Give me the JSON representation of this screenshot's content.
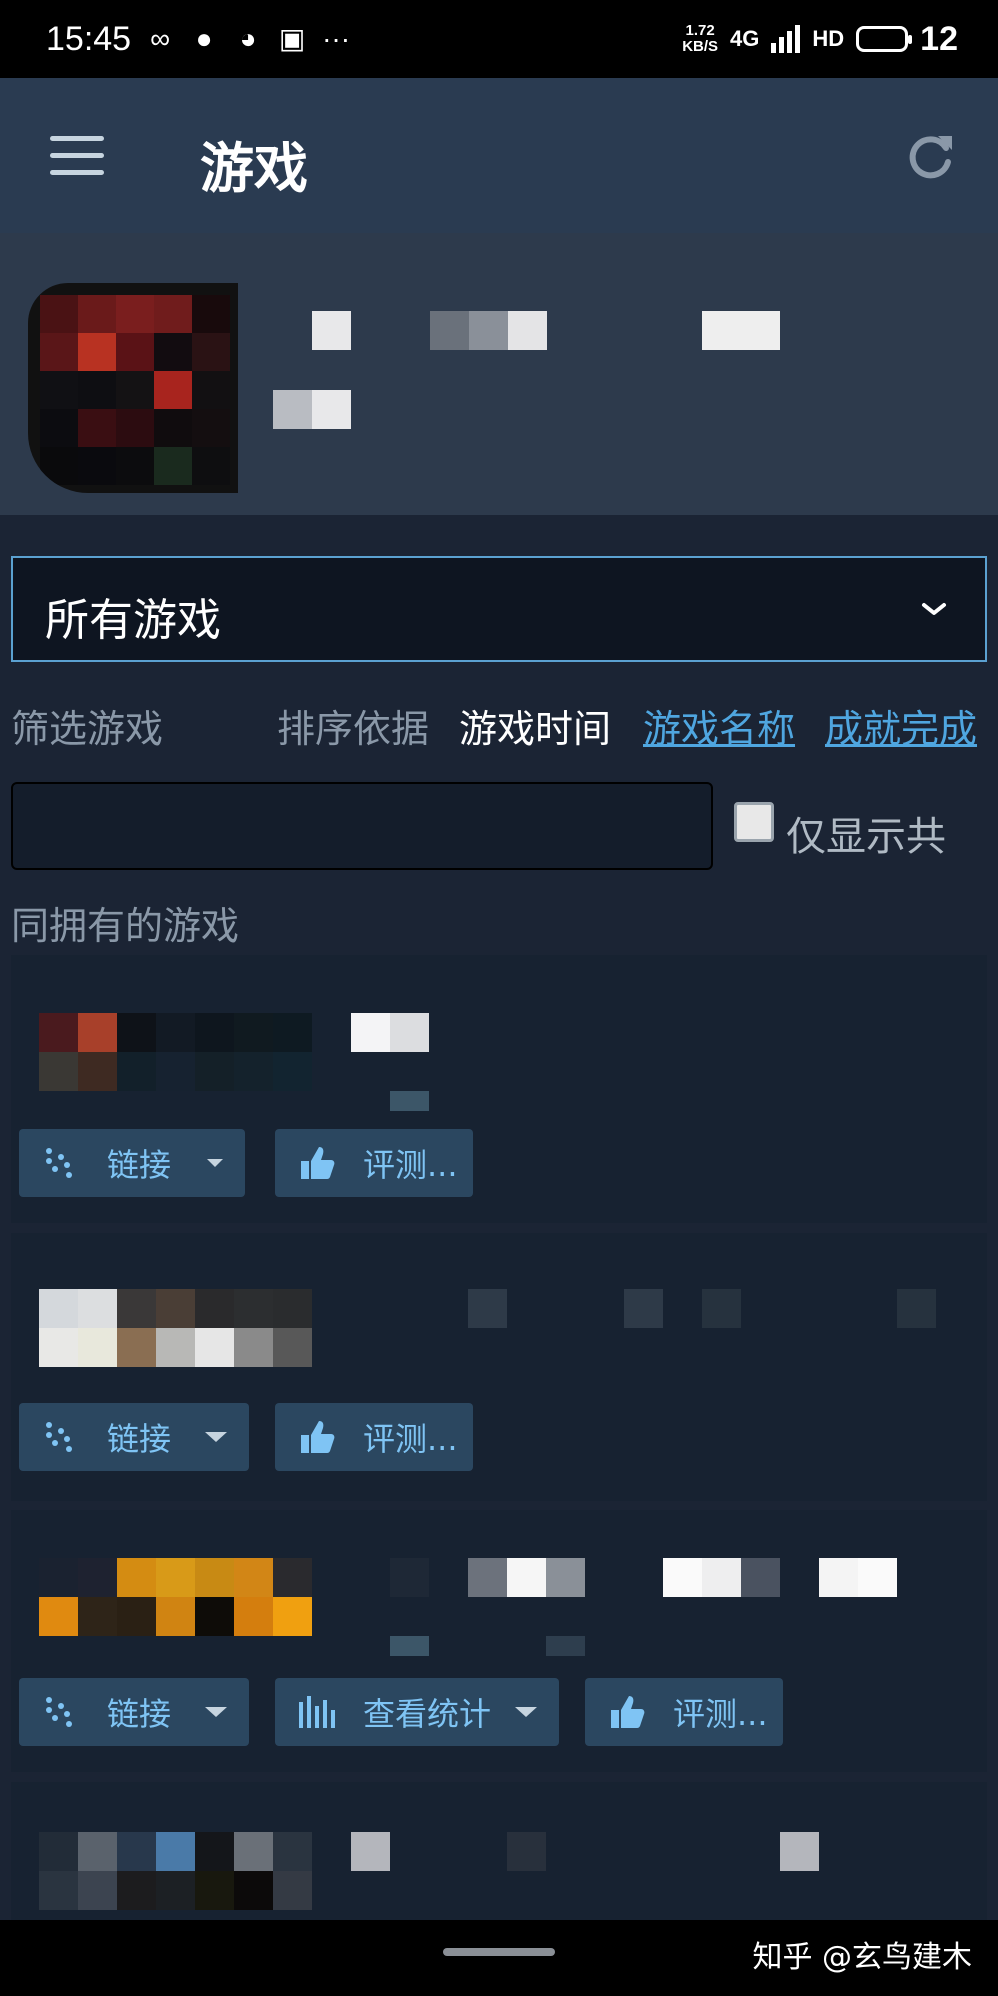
{
  "status_bar": {
    "time": "15:45",
    "left_icons": [
      "infinity-icon",
      "chat-bubble-icon",
      "wechat-icon",
      "alipay-icon",
      "more-dots-icon"
    ],
    "speed_value": "1.72",
    "speed_unit": "KB/S",
    "network": "4G",
    "hd": "HD",
    "battery": "12"
  },
  "header": {
    "title": "游戏",
    "menu_icon": "menu-icon",
    "refresh_icon": "refresh-icon"
  },
  "dropdown": {
    "selected": "所有游戏"
  },
  "filters": {
    "filter_label": "筛选游戏",
    "sort_label": "排序依据",
    "sort_options": [
      "游戏时间",
      "游戏名称",
      "成就完成"
    ]
  },
  "search": {
    "value": "",
    "placeholder": ""
  },
  "shared_only": {
    "label": "仅显示共",
    "checked": false
  },
  "section_title": "同拥有的游戏",
  "games": [
    {
      "buttons": [
        {
          "label": "链接",
          "icon": "steam-link-icon",
          "has_dropdown": true
        },
        {
          "label": "评测...",
          "icon": "thumbs-up-icon",
          "has_dropdown": false
        }
      ]
    },
    {
      "buttons": [
        {
          "label": "链接",
          "icon": "steam-link-icon",
          "has_dropdown": true
        },
        {
          "label": "评测...",
          "icon": "thumbs-up-icon",
          "has_dropdown": false
        }
      ]
    },
    {
      "buttons": [
        {
          "label": "链接",
          "icon": "steam-link-icon",
          "has_dropdown": true
        },
        {
          "label": "查看统计",
          "icon": "stats-bars-icon",
          "has_dropdown": true
        },
        {
          "label": "评测...",
          "icon": "thumbs-up-icon",
          "has_dropdown": false
        }
      ]
    },
    {
      "buttons": []
    }
  ],
  "watermark": "知乎 @玄鸟建木",
  "colors": {
    "background": "#1b2434",
    "header": "#2a3b51",
    "accent_link": "#4fa6e0",
    "button_bg": "#2b4760",
    "button_text": "#7fc4f4"
  }
}
